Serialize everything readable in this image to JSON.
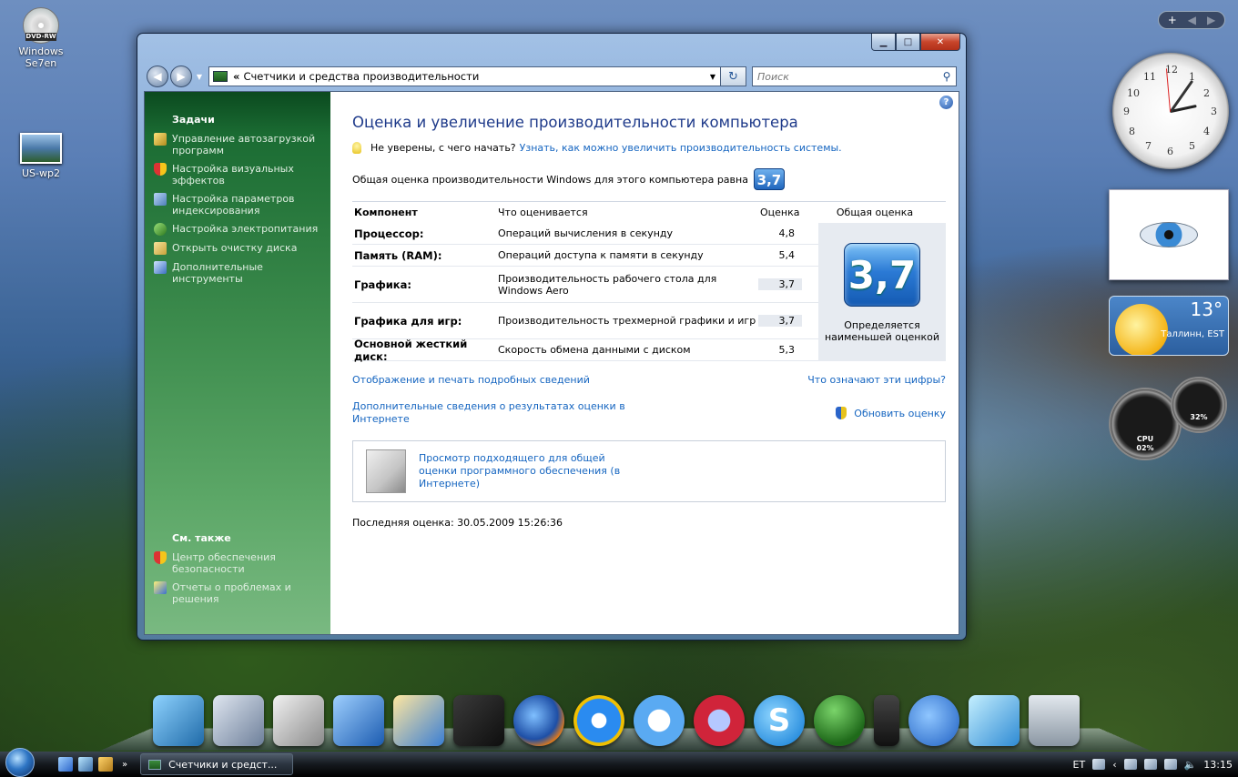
{
  "desktop": {
    "icons": [
      {
        "label": "Windows Se7en",
        "tag": "DVD-RW"
      },
      {
        "label": "US-wp2"
      }
    ]
  },
  "window": {
    "address": "Счетчики и средства производительности",
    "address_prefix": "«",
    "search_placeholder": "Поиск"
  },
  "sidebar": {
    "tasks_header": "Задачи",
    "tasks": [
      "Управление автозагрузкой программ",
      "Настройка визуальных эффектов",
      "Настройка параметров индексирования",
      "Настройка электропитания",
      "Открыть очистку диска",
      "Дополнительные инструменты"
    ],
    "see_also_header": "См. также",
    "see_also": [
      "Центр обеспечения безопасности",
      "Отчеты о проблемах и решения"
    ]
  },
  "main": {
    "title": "Оценка и увеличение производительности компьютера",
    "hint_text": "Не уверены, с чего начать?",
    "hint_link": "Узнать, как можно увеличить производительность системы.",
    "overall_text": "Общая оценка производительности Windows для этого компьютера равна",
    "overall_score": "3,7",
    "table_headers": [
      "Компонент",
      "Что оценивается",
      "Оценка",
      "Общая оценка"
    ],
    "rows": [
      {
        "component": "Процессор:",
        "what": "Операций вычисления в секунду",
        "score": "4,8"
      },
      {
        "component": "Память (RAM):",
        "what": "Операций доступа к памяти в секунду",
        "score": "5,4"
      },
      {
        "component": "Графика:",
        "what": "Производительность рабочего стола для Windows Aero",
        "score": "3,7"
      },
      {
        "component": "Графика для игр:",
        "what": "Производительность трехмерной графики и игр",
        "score": "3,7"
      },
      {
        "component": "Основной жесткий диск:",
        "what": "Скорость обмена данными с диском",
        "score": "5,3"
      }
    ],
    "big_score": "3,7",
    "big_caption": "Определяется наименьшей оценкой",
    "link_details": "Отображение и печать подробных сведений",
    "link_numbers": "Что означают эти цифры?",
    "link_online": "Дополнительные сведения о результатах оценки в Интернете",
    "refresh_label": "Обновить оценку",
    "software_link": "Просмотр подходящего для общей оценки программного обеспечения (в Интернете)",
    "last_rating": "Последняя оценка: 30.05.2009 15:26:36"
  },
  "gadgets": {
    "clock_numerals": [
      "12",
      "1",
      "2",
      "3",
      "4",
      "5",
      "6",
      "7",
      "8",
      "9",
      "10",
      "11"
    ],
    "weather_temp": "13°",
    "weather_city": "Таллинн, EST",
    "cpu_label": "CPU",
    "cpu_value": "02%",
    "mem_value": "32%"
  },
  "taskbar": {
    "task_label": "Счетчики и средст...",
    "lang": "ET",
    "time": "13:15",
    "more": "»"
  }
}
